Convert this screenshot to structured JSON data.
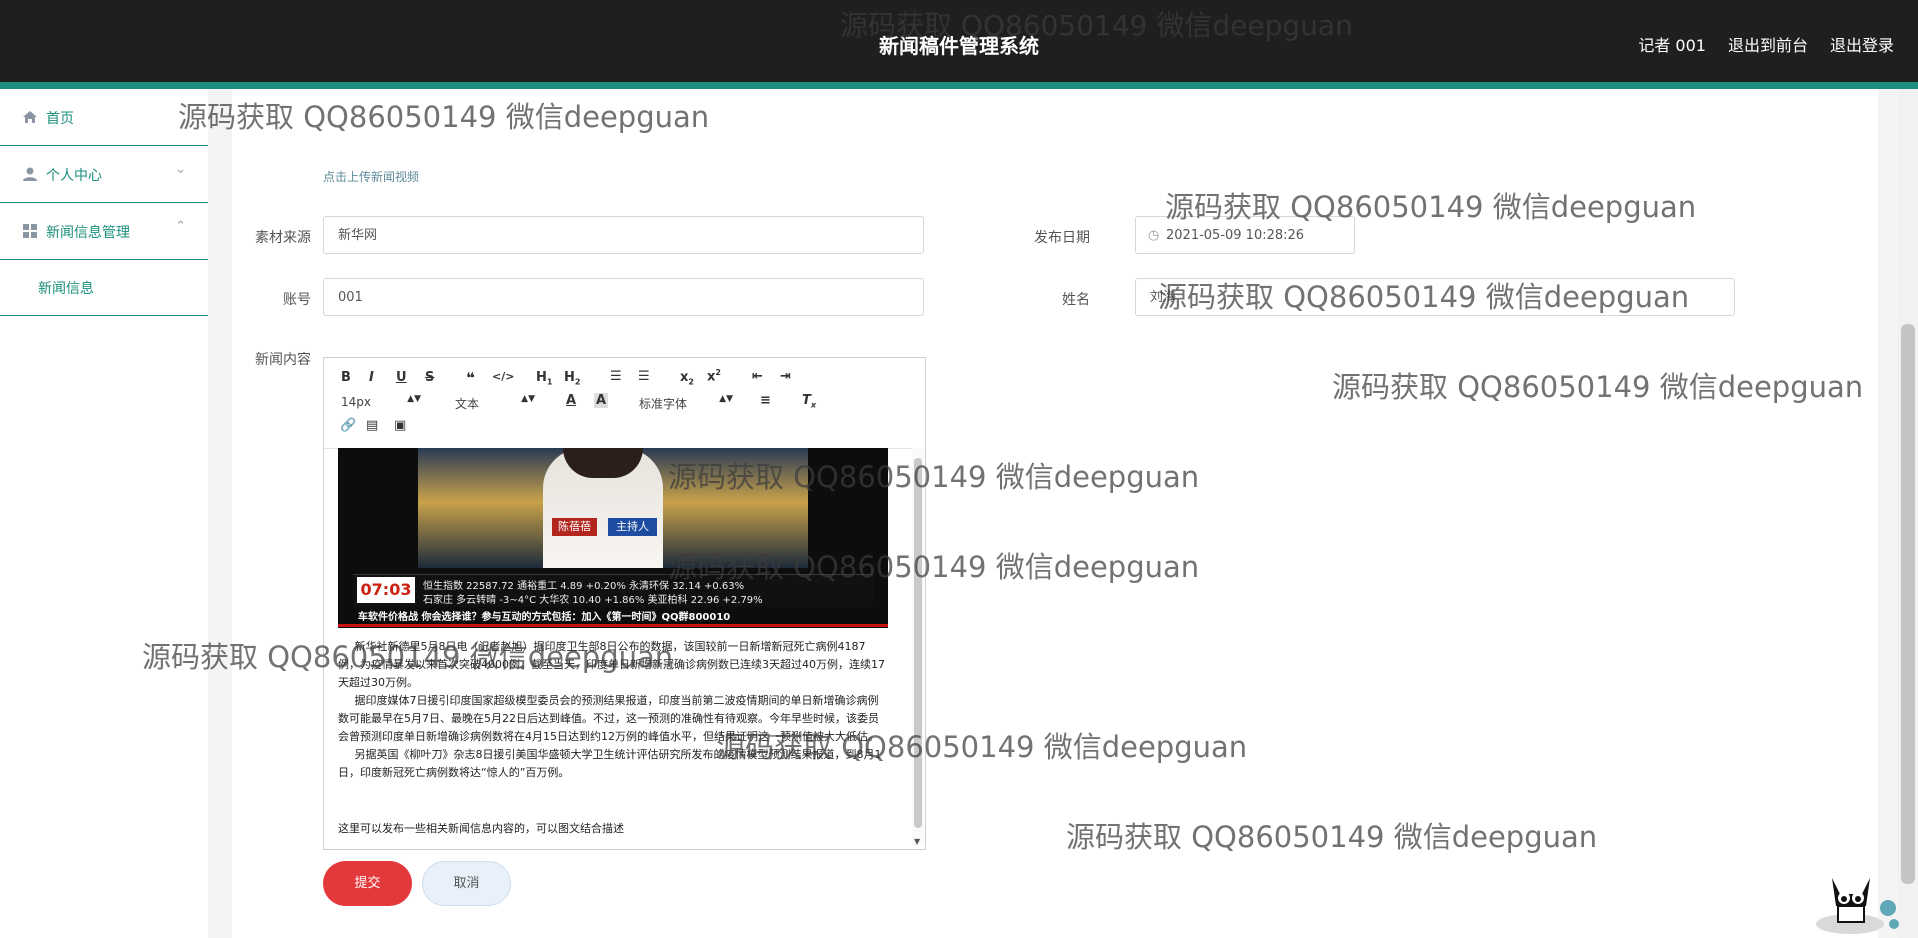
{
  "header": {
    "title": "新闻稿件管理系统",
    "user_label": "记者 001",
    "to_front_label": "退出到前台",
    "logout_label": "退出登录"
  },
  "sidebar": {
    "items": [
      {
        "label": "首页",
        "icon": "home-icon"
      },
      {
        "label": "个人中心",
        "icon": "user-icon",
        "expanded": false
      },
      {
        "label": "新闻信息管理",
        "icon": "grid-icon",
        "expanded": true
      }
    ],
    "sub_item": "新闻信息"
  },
  "form": {
    "upload_hint": "点击上传新闻视频",
    "source_label": "素材来源",
    "source_value": "新华网",
    "date_label": "发布日期",
    "date_value": "2021-05-09 10:28:26",
    "account_label": "账号",
    "account_value": "001",
    "name_label": "姓名",
    "name_value": "刘海",
    "content_label": "新闻内容"
  },
  "editor": {
    "font_size": "14px",
    "paragraph_format": "文本",
    "font_family": "标准字体",
    "video_anchor_name": "陈蓓蓓",
    "video_anchor_title": "主持人",
    "video_time": "07:03",
    "ticker_line1": "恒生指数 22587.72 通裕重工 4.89 +0.20% 永清环保 32.14 +0.63%",
    "ticker_line2": "石家庄 多云转晴 -3~4°C 大华农 10.40 +1.86% 美亚柏科 22.96 +2.79%",
    "video_banner": "车软件价格战 你会选择谁？参与互动的方式包括：加入《第一时间》QQ群800010",
    "paragraphs": [
      "新华社新德里5月8日电（记者赵旭）据印度卫生部8日公布的数据，该国较前一日新增新冠死亡病例4187例，为疫情暴发以来首次突破4000例。截至当天，印度单日新增新冠确诊病例数已连续3天超过40万例，连续17天超过30万例。",
      "据印度媒体7日援引印度国家超级模型委员会的预测结果报道，印度当前第二波疫情期间的单日新增确诊病例数可能最早在5月7日、最晚在5月22日后达到峰值。不过，这一预测的准确性有待观察。今年早些时候，该委员会曾预测印度单日新增确诊病例数将在4月15日达到约12万例的峰值水平，但结果证明这一预测值被大大低估。",
      "另据英国《柳叶刀》杂志8日援引美国华盛顿大学卫生统计评估研究所发布的疫情模型预测结果报道，到8月1日，印度新冠死亡病例数将达“惊人的”百万例。"
    ],
    "footer_line": "这里可以发布一些相关新闻信息内容的，可以图文结合描述"
  },
  "buttons": {
    "submit": "提交",
    "cancel": "取消"
  },
  "watermark": "源码获取 QQ86050149 微信deepguan",
  "colors": {
    "topbar": "#1f1f1f",
    "accent": "#1a8f7d",
    "submit": "#e4393c",
    "cancel": "#e8f1f9"
  }
}
